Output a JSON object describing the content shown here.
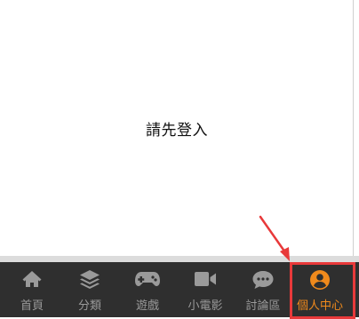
{
  "main": {
    "login_prompt": "請先登入"
  },
  "tabbar": {
    "tabs": [
      {
        "label": "首頁",
        "icon": "home-icon"
      },
      {
        "label": "分類",
        "icon": "layers-icon"
      },
      {
        "label": "遊戲",
        "icon": "gamepad-icon"
      },
      {
        "label": "小電影",
        "icon": "video-camera-icon"
      },
      {
        "label": "討論區",
        "icon": "chat-bubble-icon"
      },
      {
        "label": "個人中心",
        "icon": "user-circle-icon",
        "active": true
      }
    ],
    "colors": {
      "background": "#2f2f2f",
      "inactive": "#9a9a9a",
      "active": "#f08a1c"
    }
  },
  "annotation": {
    "highlight_color": "#e8393a",
    "highlighted_tab": "個人中心"
  }
}
